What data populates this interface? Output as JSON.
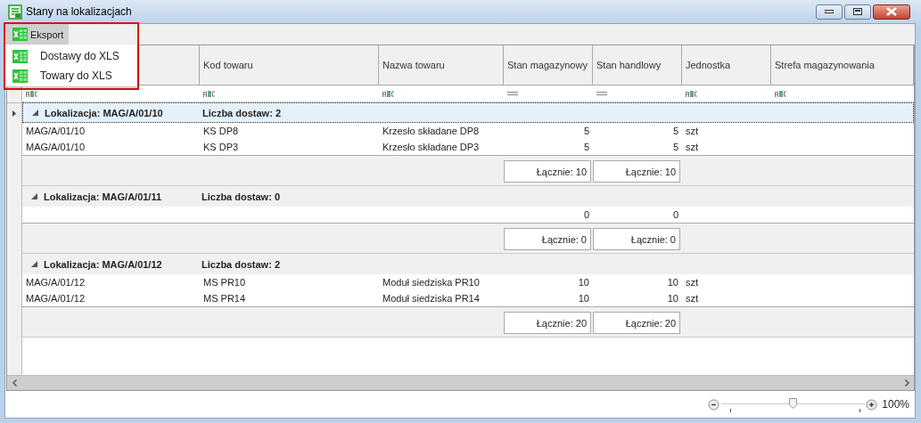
{
  "window": {
    "title": "Stany na lokalizacjach"
  },
  "toolbar": {
    "export_button": {
      "label": "Eksport",
      "expanded": true
    }
  },
  "export_menu": {
    "items": [
      {
        "label": "Dostawy do XLS"
      },
      {
        "label": "Towary do XLS"
      }
    ]
  },
  "table": {
    "columns": [
      {
        "kind": "text"
      },
      {
        "label": "Kod towaru",
        "kind": "text"
      },
      {
        "label": "Nazwa towaru",
        "kind": "text"
      },
      {
        "label": "Stan magazynowy",
        "kind": "number"
      },
      {
        "label": "Stan handlowy",
        "kind": "number"
      },
      {
        "label": "Jednostka",
        "kind": "text"
      },
      {
        "label": "Strefa magazynowania",
        "kind": "text"
      }
    ],
    "groups": [
      {
        "title": "Lokalizacja: MAG/A/01/10",
        "count": "Liczba dostaw: 2",
        "expanded": true,
        "selected": true,
        "rows": [
          {
            "location": "MAG/A/01/10",
            "code": "KS DP8",
            "name": "Krzesło składane DP8",
            "stock": "5",
            "trade": "5",
            "unit": "szt"
          },
          {
            "location": "MAG/A/01/10",
            "code": "KS DP3",
            "name": "Krzesło składane DP3",
            "stock": "5",
            "trade": "5",
            "unit": "szt"
          }
        ],
        "totals": [
          "Łącznie: 10",
          "Łącznie: 10"
        ]
      },
      {
        "title": "Lokalizacja: MAG/A/01/11",
        "count": "Liczba dostaw: 0",
        "expanded": true,
        "selected": false,
        "rows": [
          {
            "stock": "0",
            "trade": "0"
          }
        ],
        "totals": [
          "Łącznie: 0",
          "Łącznie: 0"
        ]
      },
      {
        "title": "Lokalizacja: MAG/A/01/12",
        "count": "Liczba dostaw: 2",
        "expanded": true,
        "selected": false,
        "rows": [
          {
            "location": "MAG/A/01/12",
            "code": "MS PR10",
            "name": "Moduł siedziska PR10",
            "stock": "10",
            "trade": "10",
            "unit": "szt"
          },
          {
            "location": "MAG/A/01/12",
            "code": "MS PR14",
            "name": "Moduł siedziska PR14",
            "stock": "10",
            "trade": "10",
            "unit": "szt"
          }
        ],
        "totals": [
          "Łącznie: 20",
          "Łącznie: 20"
        ]
      }
    ]
  },
  "zoom": {
    "level": 0.5,
    "label": "100%"
  }
}
